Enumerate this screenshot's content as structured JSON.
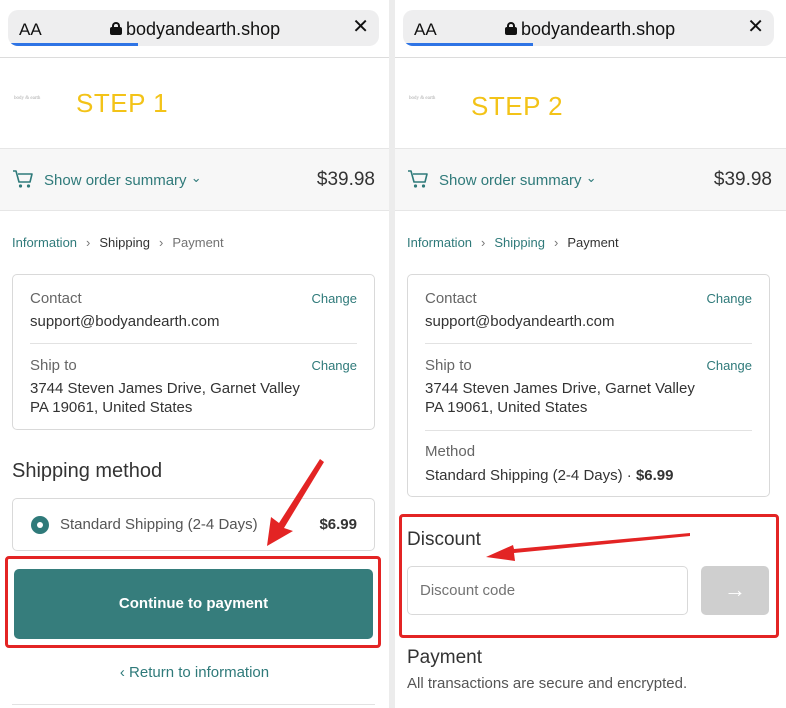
{
  "browser": {
    "aa_label": "AA",
    "url": "bodyandearth.shop",
    "close_glyph": "✕"
  },
  "shop": {
    "logo_text": "body & earth"
  },
  "steps": [
    "STEP 1",
    "STEP 2"
  ],
  "summary": {
    "label": "Show order summary",
    "chevron": "⌄",
    "price": "$39.98"
  },
  "breadcrumb": {
    "information": "Information",
    "shipping": "Shipping",
    "payment": "Payment",
    "separator": "›"
  },
  "info": {
    "contact_label": "Contact",
    "contact_value": "support@bodyandearth.com",
    "change_label": "Change",
    "ship_to_label": "Ship to",
    "ship_to_line1": "3744 Steven James Drive, Garnet Valley",
    "ship_to_line2": "PA 19061, United States",
    "method_label": "Method",
    "method_value": "Standard Shipping (2-4 Days) · ",
    "method_price": "$6.99"
  },
  "shipping_method": {
    "title": "Shipping method",
    "option_name": "Standard Shipping (2-4 Days)",
    "option_price": "$6.99"
  },
  "buttons": {
    "continue": "Continue to payment",
    "return": "‹ Return to information",
    "apply_glyph": "→"
  },
  "discount": {
    "title": "Discount",
    "placeholder": "Discount code"
  },
  "payment": {
    "title": "Payment",
    "subtitle": "All transactions are secure and encrypted."
  },
  "colors": {
    "accent": "#367d7c",
    "step": "#f3c318",
    "annotation": "#e32424",
    "link": "#2f7a7a"
  }
}
